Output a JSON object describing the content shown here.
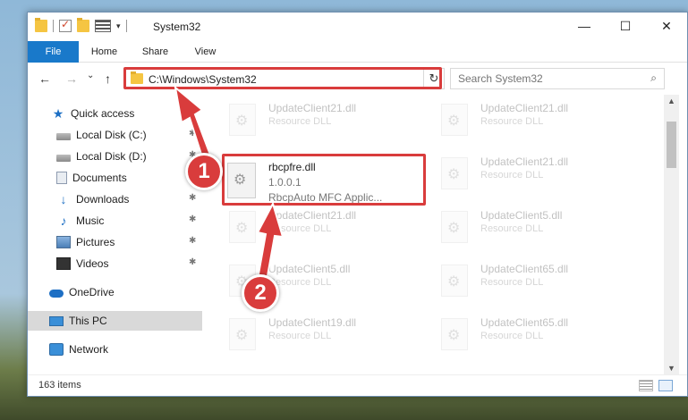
{
  "window": {
    "title": "System32",
    "controls": {
      "minimize": "—",
      "maximize": "☐",
      "close": "✕"
    }
  },
  "ribbon": {
    "tabs": [
      {
        "label": "File"
      },
      {
        "label": "Home"
      },
      {
        "label": "Share"
      },
      {
        "label": "View"
      }
    ]
  },
  "nav": {
    "back": "←",
    "forward": "→",
    "recent": "⌄",
    "up": "↑",
    "address": "C:\\Windows\\System32",
    "refresh": "↻",
    "search_placeholder": "Search System32",
    "search_icon": "⌕"
  },
  "sidebar": {
    "items": [
      {
        "label": "Quick access",
        "icon": "star-icon"
      },
      {
        "label": "Local Disk (C:)",
        "icon": "disk-icon"
      },
      {
        "label": "Local Disk (D:)",
        "icon": "disk-icon"
      },
      {
        "label": "Documents",
        "icon": "documents-icon"
      },
      {
        "label": "Downloads",
        "icon": "download-icon"
      },
      {
        "label": "Music",
        "icon": "music-icon"
      },
      {
        "label": "Pictures",
        "icon": "pictures-icon"
      },
      {
        "label": "Videos",
        "icon": "videos-icon"
      },
      {
        "label": "OneDrive",
        "icon": "cloud-icon"
      },
      {
        "label": "This PC",
        "icon": "pc-icon",
        "selected": true
      },
      {
        "label": "Network",
        "icon": "network-icon"
      }
    ]
  },
  "files": {
    "faded": [
      {
        "name": "UpdateClient21.dll",
        "desc": "Resource DLL"
      },
      {
        "name": "UpdateClient21.dll",
        "desc": "Resource DLL"
      },
      {
        "name": "UpdateClient21.dll",
        "desc": "Resource DLL"
      },
      {
        "name": "UpdateClient21.dll",
        "desc": "Resource DLL"
      },
      {
        "name": "UpdateClient5.dll",
        "desc": "Resource DLL"
      },
      {
        "name": "UpdateClient5.dll",
        "desc": "Resource DLL"
      },
      {
        "name": "UpdateClient65.dll",
        "desc": "Resource DLL"
      },
      {
        "name": "UpdateClient19.dll",
        "desc": "Resource DLL"
      },
      {
        "name": "UpdateClient65.dll",
        "desc": "Resource DLL"
      }
    ],
    "focus": {
      "name": "rbcpfre.dll",
      "version": "1.0.0.1",
      "desc": "RbcpAuto MFC Applic..."
    }
  },
  "status": {
    "count": "163 items"
  },
  "annotations": {
    "badge1": "1",
    "badge2": "2",
    "color": "#d93c3c"
  }
}
